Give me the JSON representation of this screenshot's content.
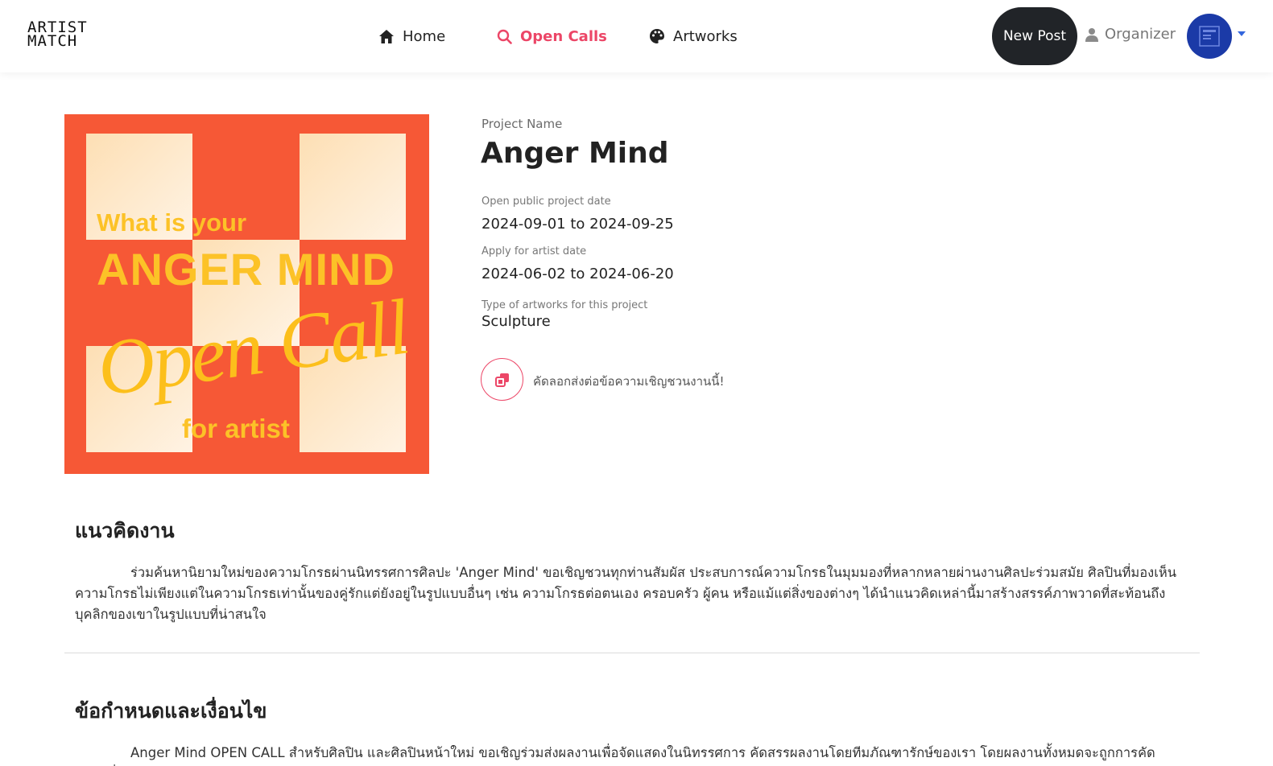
{
  "header": {
    "logo_line1": "ARTIST",
    "logo_line2": "MATCH",
    "nav": [
      {
        "label": "Home",
        "icon": "home-icon"
      },
      {
        "label": "Open Calls",
        "icon": "search-icon",
        "active": true
      },
      {
        "label": "Artworks",
        "icon": "palette-icon"
      }
    ],
    "new_post_label": "New Post",
    "role_label": "Organizer"
  },
  "poster": {
    "line1": "What is your",
    "line2": "ANGER MIND",
    "line3": "Open Call",
    "line4": "for artist"
  },
  "project": {
    "name_label": "Project Name",
    "name": "Anger Mind",
    "public_date_label": "Open public project date",
    "public_date": "2024-09-01 to 2024-09-25",
    "apply_date_label": "Apply for artist date",
    "apply_date": "2024-06-02 to 2024-06-20",
    "type_label": "Type of artworks for this project",
    "type": "Sculpture",
    "copy_text": "คัดลอกส่งต่อข้อความเชิญชวนงานนี้!"
  },
  "concept": {
    "heading": "แนวคิดงาน",
    "body": "ร่วมค้นหานิยามใหม่ของความโกรธผ่านนิทรรศการศิลปะ 'Anger Mind' ขอเชิญชวนทุกท่านสัมผัส ประสบการณ์ความโกรธในมุมมองที่หลากหลายผ่านงานศิลปะร่วมสมัย ศิลปินที่มองเห็นความโกรธไม่เพียงแต่ในความโกรธเท่านั้นของคู่รักแต่ยังอยู่ในรูปแบบอื่นๆ เช่น ความโกรธต่อตนเอง ครอบครัว ผู้คน หรือแม้แต่สิ่งของต่างๆ ได้นำแนวคิดเหล่านี้มาสร้างสรรค์ภาพวาดที่สะท้อนถึงบุคลิกของเขาในรูปแบบที่น่าสนใจ"
  },
  "terms": {
    "heading": "ข้อกำหนดและเงื่อนไข",
    "body": "Anger Mind OPEN CALL สำหรับศิลปิน และศิลปินหน้าใหม่ ขอเชิญร่วมส่งผลงานเพื่อจัดแสดงในนิทรรศการ คัดสรรผลงานโดยทีมภัณฑารักษ์ของเรา โดยผลงานทั้งหมดจะถูกการคัดเลือกเพื่อ"
  },
  "colors": {
    "accent": "#ec4667",
    "dark_button": "#212428",
    "poster_bg": "#f65836",
    "poster_text": "#fcc227",
    "avatar": "#1b3aa7"
  }
}
